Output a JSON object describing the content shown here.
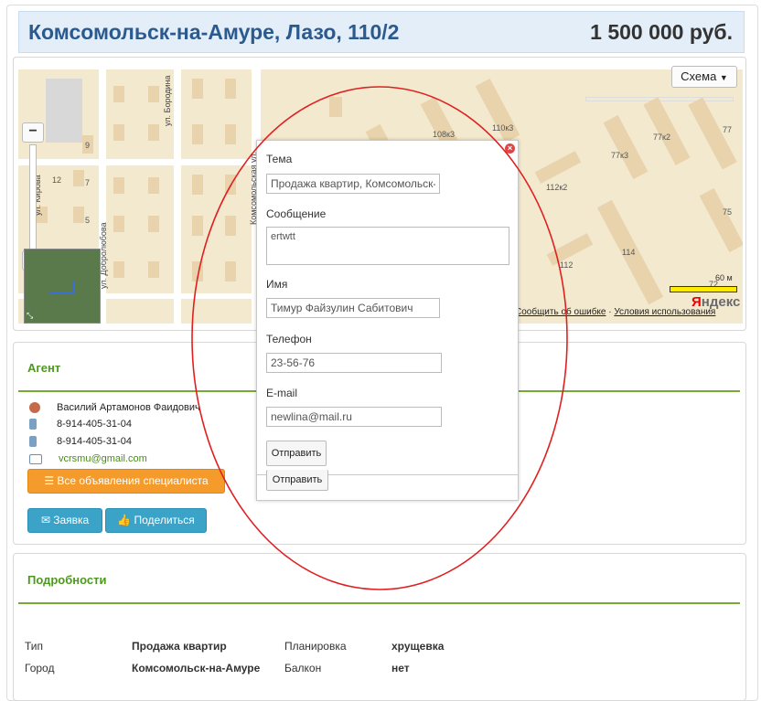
{
  "header": {
    "title": "Комсомольск-на-Амуре, Лазо, 110/2",
    "price": "1 500 000 руб."
  },
  "map": {
    "schema_label": "Схема",
    "copyright_report": "Сообщить об ошибке",
    "copyright_sep": " · ",
    "copyright_terms": "Условия использования",
    "brand": "Яндекс",
    "scale_label": "60 м",
    "zoom_in": "+",
    "zoom_out": "−",
    "streets": [
      "ул. Бородина",
      "ул. Кирова",
      "ул. Добролюбова",
      "Комсомольская ул."
    ],
    "house_numbers": [
      "108к3",
      "110к3",
      "77к3",
      "77к2",
      "77",
      "75",
      "112к2",
      "114",
      "112",
      "12",
      "9",
      "7",
      "5",
      "72"
    ]
  },
  "agent": {
    "title": "Агент",
    "name": "Василий Артамонов Фаидович",
    "phone1": "8-914-405-31-04",
    "phone2": "8-914-405-31-04",
    "email": "vcrsmu@gmail.com",
    "all_ads_button": "Все объявления специалиста",
    "request_button": "Заявка",
    "share_button": "Поделиться"
  },
  "dialog": {
    "subject_label": "Тема",
    "subject_value": "Продажа квартир, Комсомольск-на-Амуре",
    "message_label": "Сообщение",
    "message_value": "ertwtt",
    "name_label": "Имя",
    "name_value": "Тимур Файзулин Сабитович",
    "phone_label": "Телефон",
    "phone_value": "23-56-76",
    "email_label": "E-mail",
    "email_value": "newlina@mail.ru",
    "send_button": "Отправить",
    "send_button_behind": "Отправить",
    "close": "×"
  },
  "details": {
    "title": "Подробности",
    "rows": [
      {
        "label": "Тип",
        "value": "Продажа квартир",
        "label2": "Планировка",
        "value2": "хрущевка"
      },
      {
        "label": "Город",
        "value": "Комсомольск-на-Амуре",
        "label2": "Балкон",
        "value2": "нет"
      }
    ]
  },
  "colors": {
    "accent_green": "#4c9a1d",
    "header_blue": "#2b5a8e",
    "annotation_red": "#e02020",
    "orange_button": "#f59b2b",
    "teal_button": "#3aa3c7"
  }
}
